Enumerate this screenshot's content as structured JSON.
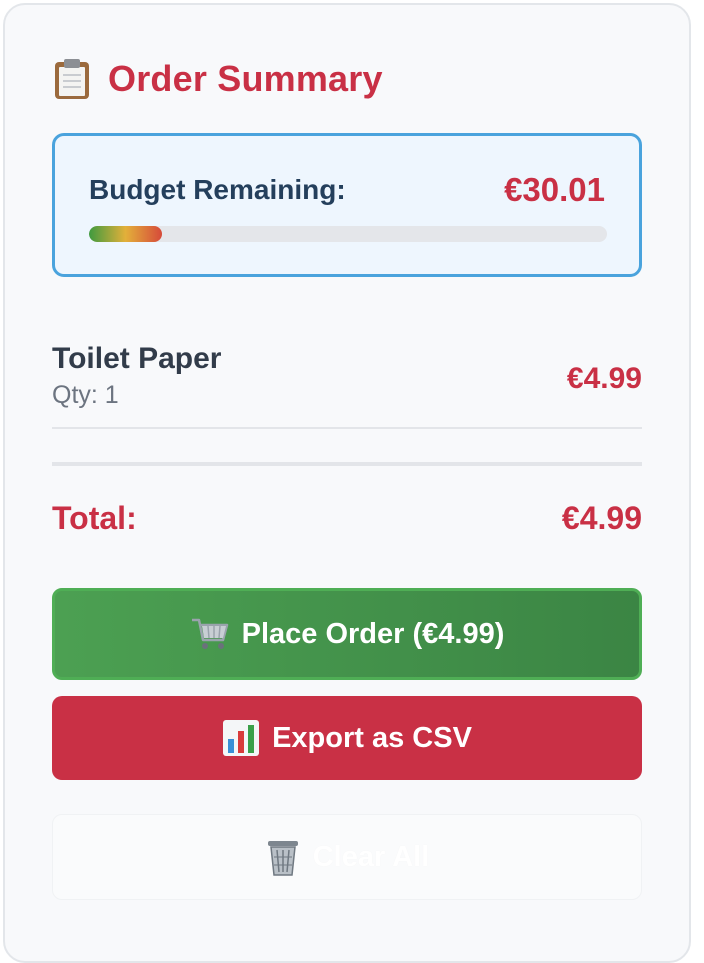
{
  "summary": {
    "title": "Order Summary",
    "title_icon": "clipboard-icon"
  },
  "budget": {
    "label": "Budget Remaining:",
    "value": "€30.01",
    "progress_percent": 14
  },
  "items": [
    {
      "name": "Toilet Paper",
      "qty_label": "Qty: 1",
      "price": "€4.99"
    }
  ],
  "total": {
    "label": "Total:",
    "value": "€4.99"
  },
  "buttons": {
    "place_order": {
      "label": "Place Order (€4.99)",
      "icon": "shopping-cart-icon"
    },
    "export_csv": {
      "label": "Export as CSV",
      "icon": "bar-chart-icon"
    },
    "clear_all": {
      "label": "Clear All",
      "icon": "trash-icon"
    }
  },
  "colors": {
    "accent": "#c93045",
    "budget_border": "#4aa3dd",
    "place_order_bg": "#4ca052",
    "export_bg": "#c93045"
  }
}
